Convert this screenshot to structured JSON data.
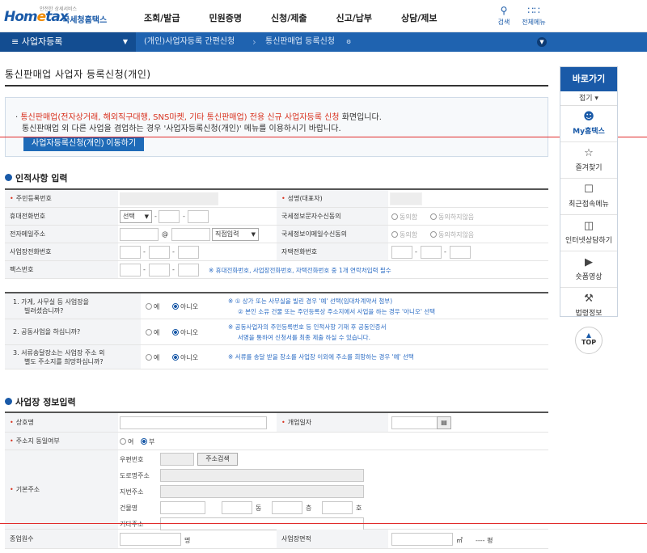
{
  "logo": {
    "small": "안전한 상세서비스",
    "main_a": "Hom",
    "main_e": "e",
    "main_b": "tax",
    "sub": "국세청홈택스"
  },
  "gnb": [
    "조회/발급",
    "민원증명",
    "신청/제출",
    "신고/납부",
    "상담/제보"
  ],
  "tools": {
    "search": "검색",
    "all_menu": "전체메뉴"
  },
  "bar": {
    "section": "사업자등록",
    "crumb1": "(개인)사업자등록 간편신청",
    "crumb2": "통신판매업 등록신청"
  },
  "page_title": "통신판매업 사업자 등록신청(개인)",
  "notice": {
    "line1_red": "통신판매업(전자상거래, 해외직구대행, SNS마켓, 기타 통신판매업) 전용 신규 사업자등록 신청",
    "line1_rest": " 화면입니다.",
    "line2": "통신판매업 외 다른 사업을 겸업하는 경우 '사업자등록신청(개인)' 메뉴를 이용하시기 바랍니다.",
    "button": "사업자등록신청(개인) 이동하기"
  },
  "section1": "인적사항 입력",
  "personal": {
    "rrn": "주민등록번호",
    "name": "성명(대표자)",
    "mobile": "휴대전화번호",
    "mobile_select": "선택",
    "sms_consent": "국세정보문자수신동의",
    "agree": "동의함",
    "disagree": "동의하지않음",
    "email": "전자메일주소",
    "at": "@",
    "email_select": "직접입력",
    "email_consent": "국세정보이메일수신동의",
    "biz_phone": "사업장전화번호",
    "home_phone": "자택전화번호",
    "fax": "팩스번호",
    "fax_note": "※ 휴대전화번호, 사업장전화번호, 자택전화번호 중 1개 연락처입력 필수",
    "dash": "-"
  },
  "questions": [
    {
      "q1": "1. 가게, 사무실 등 사업장을",
      "q2": "빌려셨습니까?",
      "yes": "예",
      "no": "아니오",
      "n1": "※ ① 상가 또는 사무실을 빌린 경우 '예' 선택(임대차계약서 첨부)",
      "n2": "② 본인 소유 건물 또는 주민등록상 주소지에서 사업을 하는 경우 '아니오' 선택"
    },
    {
      "q1": "2. 공동사업을 하십니까?",
      "q2": "",
      "yes": "예",
      "no": "아니오",
      "n1": "※ 공동사업자의 주민등록번호 등 인적사항 기재 후 공동인증서",
      "n2": "서명을 통하여 신청서를 최종 제출 하실 수 있습니다."
    },
    {
      "q1": "3. 서류송달장소는 사업장 주소 외",
      "q2": "별도 주소지를 희망하십니까?",
      "yes": "예",
      "no": "아니오",
      "n1": "※ 서류를 송달 받을 장소를 사업장 이외에 주소를 희망하는 경우 '예' 선택",
      "n2": ""
    }
  ],
  "section2": "사업장 정보입력",
  "biz": {
    "trade_name": "상호명",
    "open_date": "개업일자",
    "same_addr": "주소지 동일여부",
    "yeo": "여",
    "bu": "부",
    "base_addr": "기본주소",
    "zip": "우편번호",
    "addr_search": "주소검색",
    "road": "도로명주소",
    "jibun": "지번주소",
    "building": "건물명",
    "dong": "동",
    "floor": "층",
    "ho": "호",
    "etc": "기타주소",
    "employees": "종업원수",
    "myeong": "명",
    "area": "사업장면적",
    "sqm": "㎡",
    "pyeong": "---- 평"
  },
  "side": {
    "header": "바로가기",
    "fold": "접기 ▾",
    "items": [
      "My홈택스",
      "즐겨찾기",
      "최근접속메뉴",
      "인터넷상담하기",
      "숏폼영상",
      "법령정보"
    ],
    "top": "TOP"
  },
  "colors": {
    "brand": "#1a5aa8",
    "bar": "#1f63b0",
    "bar_dark": "#134d91",
    "required": "#d8311e",
    "guide_line": "#e12b2b"
  }
}
